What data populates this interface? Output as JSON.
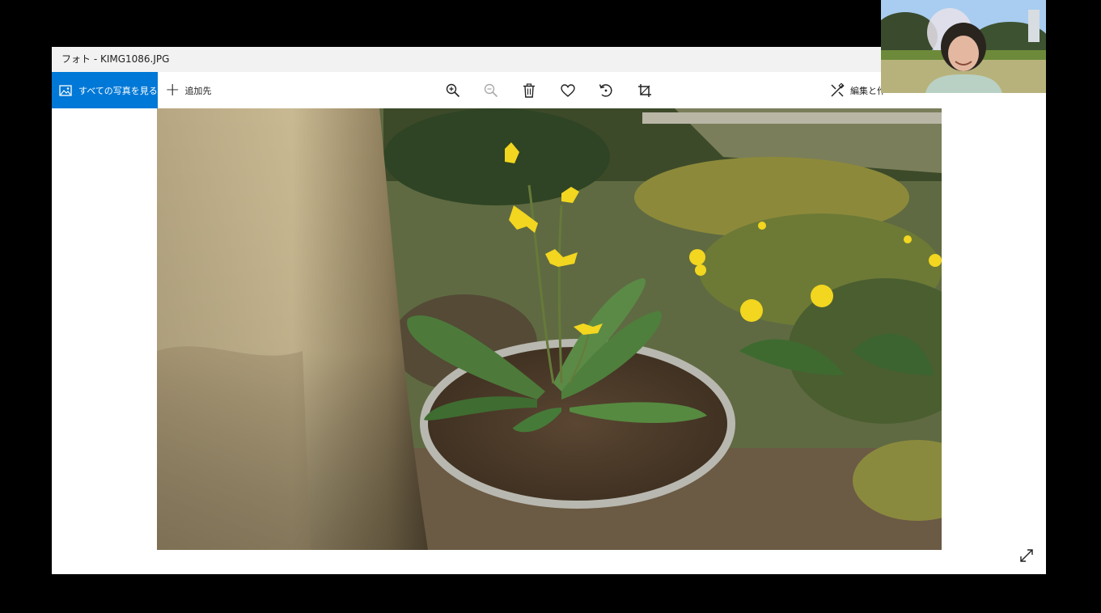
{
  "window": {
    "title": "フォト - KIMG1086.JPG"
  },
  "toolbar": {
    "see_all_label": "すべての写真を見る",
    "see_all_icon": "photo-icon",
    "add_to_label": "追加先",
    "add_to_icon": "plus-icon",
    "zoom_in_icon": "zoom-in-icon",
    "zoom_out_icon": "zoom-out-icon",
    "delete_icon": "trash-icon",
    "favorite_icon": "heart-icon",
    "rotate_icon": "rotate-icon",
    "crop_icon": "crop-icon",
    "edit_create_label": "編集と作",
    "edit_create_icon": "edit-create-icon"
  },
  "viewer": {
    "expand_icon": "expand-icon"
  },
  "colors": {
    "accent": "#0078d7",
    "titlebar": "#f2f2f2",
    "background": "#000000"
  }
}
